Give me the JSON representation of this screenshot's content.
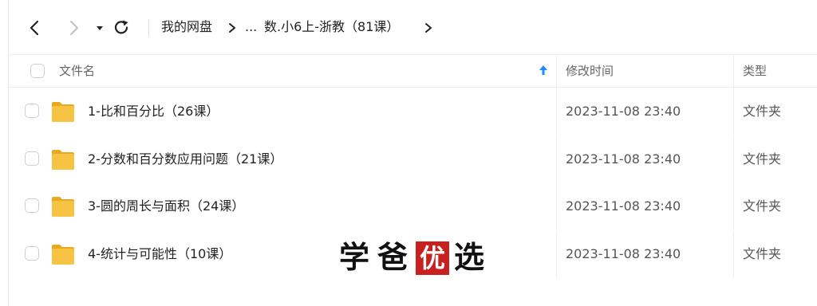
{
  "toolbar": {
    "breadcrumb": {
      "root": "我的网盘",
      "ellipsis": "...",
      "current": "数.小6上-浙教（81课）"
    }
  },
  "columns": {
    "name": "文件名",
    "modified": "修改时间",
    "type": "类型"
  },
  "files": [
    {
      "name": "1-比和百分比（26课）",
      "modified": "2023-11-08 23:40",
      "type": "文件夹"
    },
    {
      "name": "2-分数和百分数应用问题（21课）",
      "modified": "2023-11-08 23:40",
      "type": "文件夹"
    },
    {
      "name": "3-圆的周长与面积（24课）",
      "modified": "2023-11-08 23:40",
      "type": "文件夹"
    },
    {
      "name": "4-统计与可能性（10课）",
      "modified": "2023-11-08 23:40",
      "type": "文件夹"
    }
  ],
  "watermark": {
    "char1": "学",
    "char2": "爸",
    "seal": "优",
    "char4": "选"
  },
  "colors": {
    "folder": "#f6c343",
    "folder_dark": "#e9a91f",
    "sort_arrow": "#1a8cff",
    "seal": "#c8201f"
  }
}
